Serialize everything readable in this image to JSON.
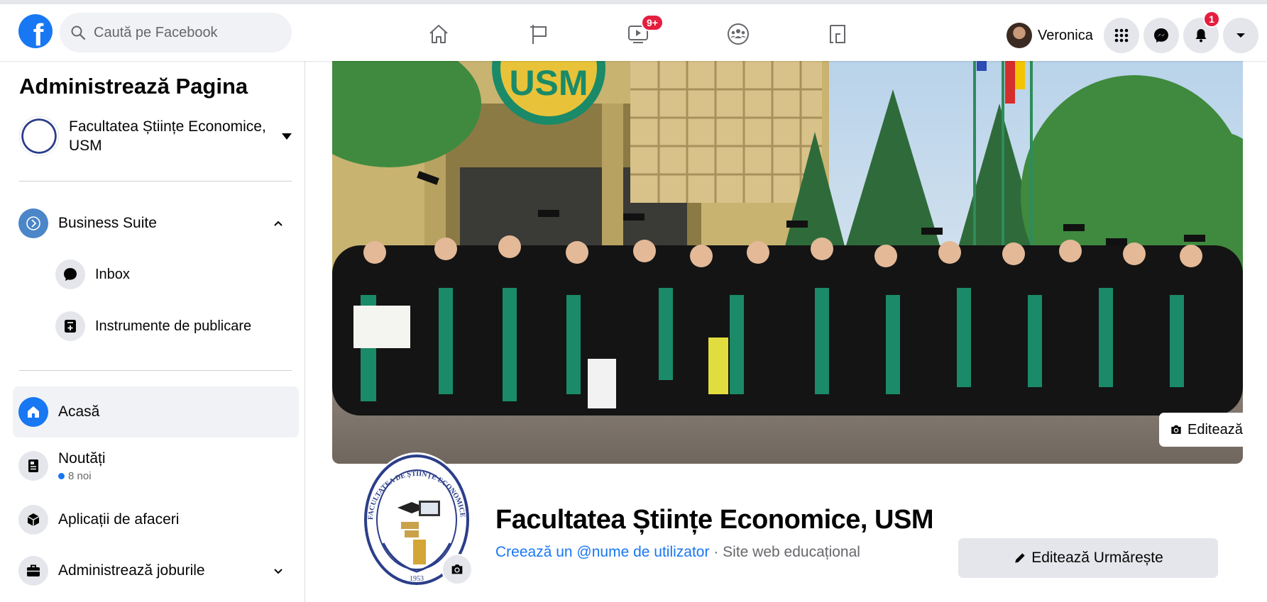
{
  "header": {
    "logo_letter": "f",
    "search_placeholder": "Caută pe Facebook",
    "watch_badge": "9+",
    "profile_name": "Veronica",
    "notifications_badge": "1"
  },
  "sidebar": {
    "title": "Administrează Pagina",
    "page_name": "Facultatea Științe Economice, USM",
    "business_suite": "Business Suite",
    "inbox": "Inbox",
    "publishing_tools": "Instrumente de publicare",
    "home": "Acasă",
    "news": "Noutăți",
    "news_sub": "8 noi",
    "business_apps": "Aplicații de afaceri",
    "manage_jobs": "Administrează joburile"
  },
  "main": {
    "cover_sign": "USM",
    "edit_cover": "Editează",
    "page_title": "Facultatea Științe Economice, USM",
    "create_username": "Creează un @nume de utilizator",
    "separator": " · ",
    "category": "Site web educațional",
    "edit_follow": "Editează Urmărește",
    "logo_ring_text": "FACULTATEA DE ȘTIINȚE ECONOMICE",
    "logo_year": "1953"
  },
  "colors": {
    "brand": "#1877f2",
    "badge": "#e41e3f",
    "academic_green": "#1a8a68"
  }
}
